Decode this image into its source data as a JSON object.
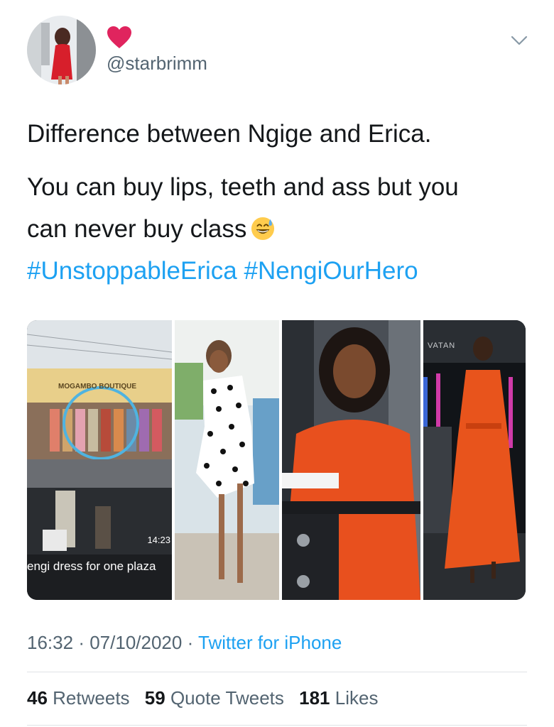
{
  "author": {
    "handle": "@starbrimm",
    "display_icon": "heart-icon"
  },
  "tweet": {
    "line1": "Difference between Ngige and Erica.",
    "line2": "You can buy lips, teeth and ass but you",
    "line3": "can never buy class",
    "emoji": "sweat-smile-emoji",
    "hashtags": [
      "#UnstoppableErica",
      "#NengiOurHero"
    ]
  },
  "media": {
    "photo1": {
      "store_sign": "MOGAMBO BOUTIQUE",
      "time": "14:23",
      "caption": "engi dress for one plaza"
    },
    "photo4": {
      "sign_text": "VATAN"
    }
  },
  "meta": {
    "time": "16:32",
    "separator": "·",
    "date": "07/10/2020",
    "source": "Twitter for iPhone"
  },
  "stats": {
    "retweets_count": "46",
    "retweets_label": "Retweets",
    "quotes_count": "59",
    "quotes_label": "Quote Tweets",
    "likes_count": "181",
    "likes_label": "Likes"
  },
  "colors": {
    "link": "#1da1f2",
    "muted": "#536471",
    "text": "#14171a",
    "heart": "#e0245e"
  }
}
